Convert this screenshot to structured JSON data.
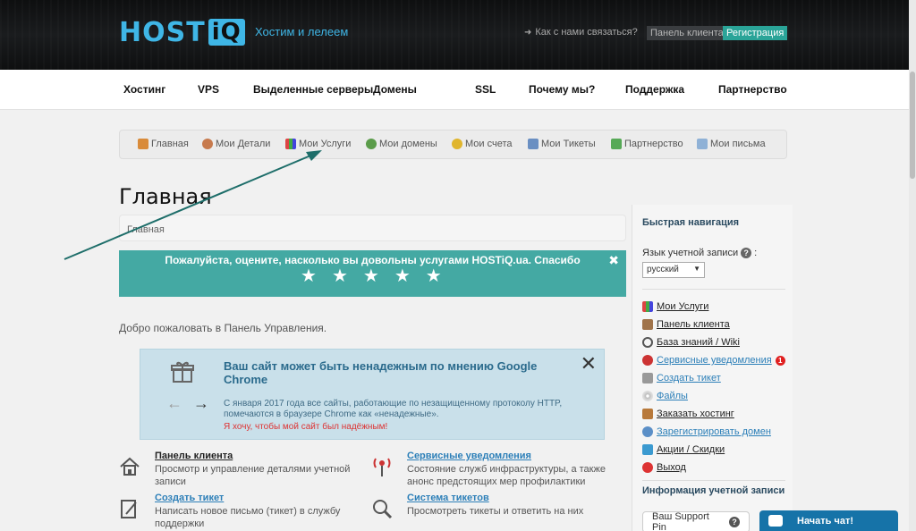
{
  "header": {
    "logo_host": "HOST",
    "logo_iq": "iQ",
    "slogan": "Хостим и лелеем",
    "contact": "Как с нами связаться?",
    "client_panel": "Панель клиента",
    "register": "Регистрация"
  },
  "mainnav": {
    "items": [
      "Хостинг",
      "VPS",
      "Выделенные серверы",
      "Домены",
      "SSL",
      "Почему мы?",
      "Поддержка",
      "Партнерство"
    ]
  },
  "subnav": {
    "items": [
      {
        "label": "Главная",
        "icon": "home-icon"
      },
      {
        "label": "Мои Детали",
        "icon": "user-icon"
      },
      {
        "label": "Мои Услуги",
        "icon": "chart-icon"
      },
      {
        "label": "Мои домены",
        "icon": "globe-icon"
      },
      {
        "label": "Мои счета",
        "icon": "coins-icon"
      },
      {
        "label": "Мои Тикеты",
        "icon": "ticket-icon"
      },
      {
        "label": "Партнерство",
        "icon": "handshake-icon"
      },
      {
        "label": "Мои письма",
        "icon": "envelope-icon"
      }
    ]
  },
  "page": {
    "title": "Главная",
    "breadcrumb": "Главная",
    "welcome": "Добро пожаловать в Панель Управления."
  },
  "rating": {
    "text": "Пожалуйста, оцените, насколько вы довольны услугами HOSTiQ.ua. Спасибо",
    "close": "✖",
    "star_count": 5
  },
  "warning": {
    "title": "Ваш сайт может быть ненадежным по мнению Google Chrome",
    "body": "С января 2017 года все сайты, работающие по незащищенному протоколу HTTP, помечаются в браузере Chrome как «ненадежные».",
    "link": "Я хочу, чтобы мой сайт был надёжным!",
    "close": "✕"
  },
  "tiles": [
    {
      "name": "Панель клиента",
      "desc": "Просмотр и управление деталями учетной записи",
      "icon": "house-icon"
    },
    {
      "name": "Сервисные уведомления",
      "desc": "Состояние служб инфраструктуры, а также анонс предстоящих мер профилактики",
      "icon": "antenna-icon"
    },
    {
      "name": "Создать тикет",
      "desc": "Написать новое письмо (тикет) в службу поддержки",
      "icon": "pencil-icon"
    },
    {
      "name": "Система тикетов",
      "desc": "Просмотреть тикеты и ответить на них",
      "icon": "magnifier-icon"
    }
  ],
  "sidebar": {
    "quick_nav": "Быстрая навигация",
    "lang_label": "Язык учетной записи",
    "lang_colon": ":",
    "lang_value": "русский",
    "links": [
      {
        "label": "Мои Услуги",
        "icon": "chart-icon",
        "blue": false
      },
      {
        "label": "Панель клиента",
        "icon": "house-icon",
        "blue": false
      },
      {
        "label": "База знаний / Wiki",
        "icon": "magnifier-icon",
        "blue": false
      },
      {
        "label": "Сервисные уведомления",
        "icon": "antenna-icon",
        "blue": true,
        "badge": "1"
      },
      {
        "label": "Создать тикет",
        "icon": "pencil-icon",
        "blue": true
      },
      {
        "label": "Файлы",
        "icon": "disc-icon",
        "blue": true
      },
      {
        "label": "Заказать хостинг",
        "icon": "box-icon",
        "blue": false
      },
      {
        "label": "Зарегистрировать домен",
        "icon": "globe-icon",
        "blue": true
      },
      {
        "label": "Акции / Скидки",
        "icon": "gift-icon",
        "blue": false
      },
      {
        "label": "Выход",
        "icon": "power-icon",
        "blue": false
      }
    ],
    "account_info": "Информация учетной записи",
    "pin_label": "Ваш Support Pin",
    "help": "?"
  },
  "chat": {
    "label": "Начать чат!"
  },
  "colors": {
    "accent": "#3fb6e6",
    "teal": "#44a9a3",
    "chat": "#1673a8"
  }
}
